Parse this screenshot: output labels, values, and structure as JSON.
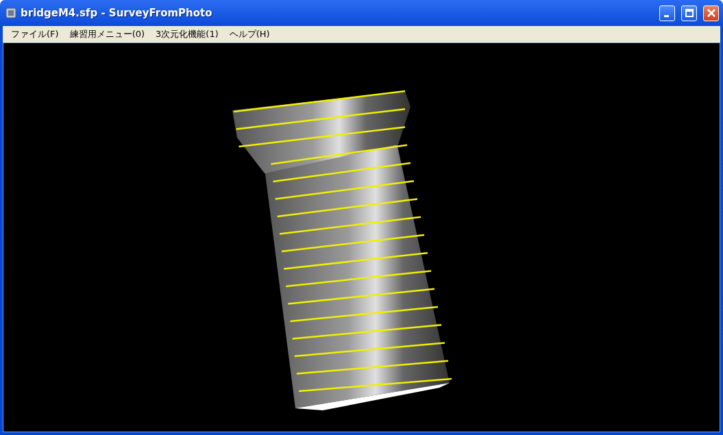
{
  "window": {
    "title": "bridgeM4.sfp - SurveyFromPhoto"
  },
  "menu": [
    {
      "label": "ファイル(F)"
    },
    {
      "label": "練習用メニュー(0)"
    },
    {
      "label": "3次元化機能(1)"
    },
    {
      "label": "ヘルプ(H)"
    }
  ]
}
